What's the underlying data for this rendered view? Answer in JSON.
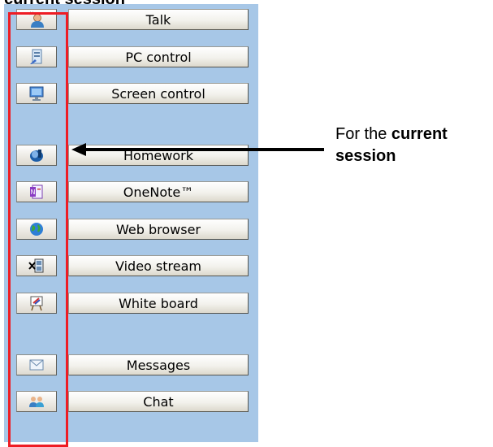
{
  "top_caption": "current session",
  "buttons": [
    {
      "id": "talk",
      "label": "Talk",
      "icon": "talk-icon"
    },
    {
      "id": "pc-control",
      "label": "PC control",
      "icon": "pc-control-icon"
    },
    {
      "id": "screen-control",
      "label": "Screen control",
      "icon": "screen-control-icon"
    },
    {
      "id": "homework",
      "label": "Homework",
      "icon": "homework-icon"
    },
    {
      "id": "onenote",
      "label": "OneNote™",
      "icon": "onenote-icon"
    },
    {
      "id": "web-browser",
      "label": "Web browser",
      "icon": "web-browser-icon"
    },
    {
      "id": "video-stream",
      "label": "Video stream",
      "icon": "video-stream-icon"
    },
    {
      "id": "white-board",
      "label": "White board",
      "icon": "white-board-icon"
    },
    {
      "id": "messages",
      "label": "Messages",
      "icon": "messages-icon"
    },
    {
      "id": "chat",
      "label": "Chat",
      "icon": "chat-icon"
    }
  ],
  "callout": {
    "prefix": "For the ",
    "bold1": "current",
    "bold2": "session"
  },
  "colors": {
    "panel": "#a7c7e7",
    "highlight": "#ee1c24",
    "arrow": "#000000"
  }
}
